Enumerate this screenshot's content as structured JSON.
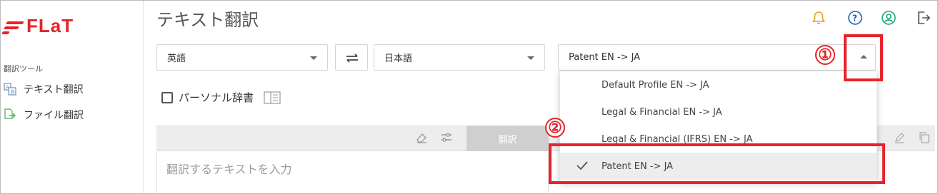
{
  "app": {
    "logo_text": "FLaT",
    "page_title": "テキスト翻訳"
  },
  "sidebar": {
    "section_label": "翻訳ツール",
    "items": [
      {
        "label": "テキスト翻訳",
        "icon": "text-translate-icon"
      },
      {
        "label": "ファイル翻訳",
        "icon": "file-translate-icon"
      }
    ]
  },
  "header_icons": [
    "bell-icon",
    "help-icon",
    "account-icon",
    "logout-icon"
  ],
  "colors": {
    "brand_red": "#e8232a",
    "bell_orange": "#f39c12",
    "help_blue": "#1e63b8",
    "account_teal": "#1aa67a",
    "annotation_red": "#e8232a"
  },
  "translator": {
    "source_language": "英語",
    "target_language": "日本語",
    "profile": "Patent EN -> JA",
    "personal_dict_label": "パーソナル辞書",
    "personal_dict_checked": false,
    "translate_button": "翻訳",
    "input_placeholder": "翻訳するテキストを入力"
  },
  "profile_menu": {
    "items": [
      {
        "label": "Default Profile EN -> JA",
        "selected": false
      },
      {
        "label": "Legal & Financial EN -> JA",
        "selected": false
      },
      {
        "label": "Legal & Financial (IFRS) EN -> JA",
        "selected": false
      },
      {
        "label": "Patent EN -> JA",
        "selected": true
      }
    ]
  },
  "annotations": {
    "step1": "①",
    "step2": "②"
  }
}
